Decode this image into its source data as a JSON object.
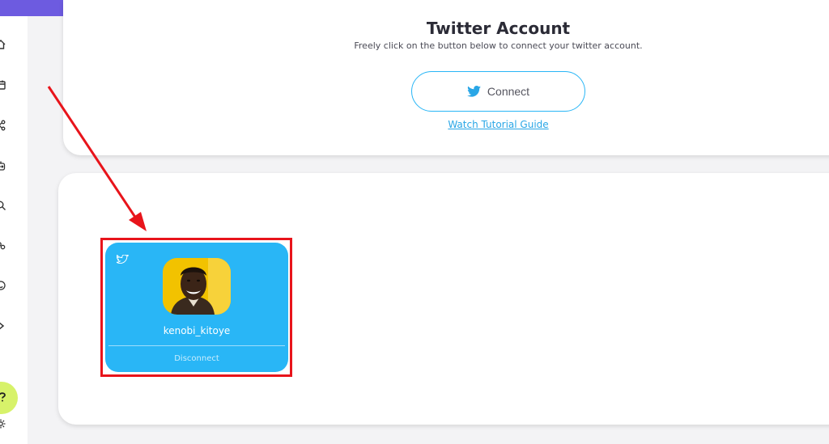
{
  "header": {
    "title": "Twitter Account",
    "subtitle": "Freely click on the button below to connect your twitter account."
  },
  "connect": {
    "label": "Connect",
    "icon": "twitter-icon"
  },
  "tutorial": {
    "label": "Watch Tutorial Guide"
  },
  "sidebar": {
    "icons": [
      "home-icon",
      "calendar-icon",
      "share-icon",
      "bot-icon",
      "search-icon",
      "users-icon",
      "smile-icon",
      "chevron-right-icon",
      "help-icon",
      "settings-icon"
    ]
  },
  "account": {
    "username": "kenobi_kitoye",
    "disconnect_label": "Disconnect",
    "icon": "twitter-icon"
  },
  "colors": {
    "brand": "#6d5be0",
    "twitter": "#29b6f6",
    "highlight": "#e8141b",
    "help_bubble": "#d7f26a"
  }
}
